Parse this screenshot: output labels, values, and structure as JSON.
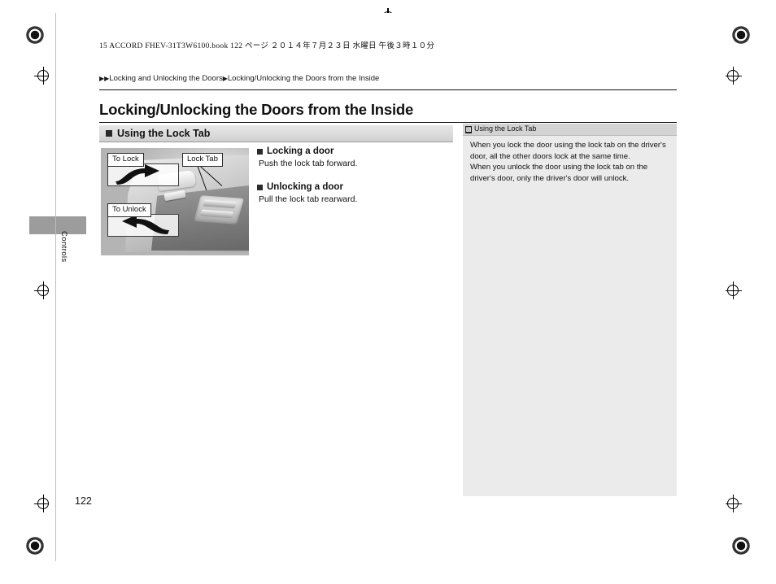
{
  "print_header": {
    "text_latin": "15 ACCORD FHEV-31T3W6100.book   122 ページ   ２０１４年７月２３日   水曜日   午後３時１０分"
  },
  "breadcrumb": {
    "arrow1": "▶▶",
    "item1": "Locking and Unlocking the Doors",
    "arrow2": "▶",
    "item2": "Locking/Unlocking the Doors from the Inside"
  },
  "page_title": "Locking/Unlocking the Doors from the Inside",
  "section": {
    "title": "Using the Lock Tab"
  },
  "illustration": {
    "callout_to_lock": "To Lock",
    "callout_to_unlock": "To Unlock",
    "callout_lock_tab": "Lock Tab"
  },
  "body": [
    {
      "heading": "Locking a door",
      "text": "Push the lock tab forward."
    },
    {
      "heading": "Unlocking a door",
      "text": "Pull the lock tab rearward."
    }
  ],
  "note": {
    "marker": "▧",
    "title": "Using the Lock Tab",
    "paragraph1": "When you lock the door using the lock tab on the driver's door, all the other doors lock at the same time.",
    "paragraph2": "When you unlock the door using the lock tab on the driver's door, only the driver's door will unlock."
  },
  "sidebar": {
    "chapter_label": "Controls"
  },
  "page_number": "122"
}
